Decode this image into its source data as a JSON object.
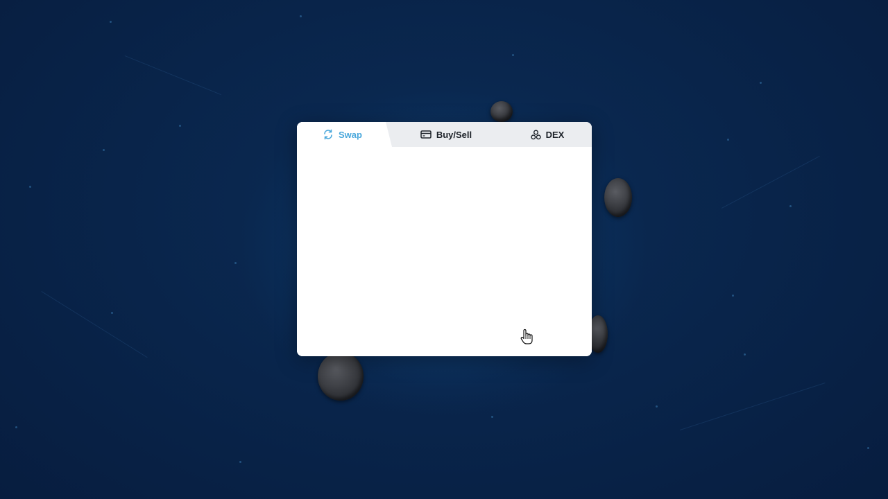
{
  "widget": {
    "tabs": [
      {
        "label": "Swap",
        "icon": "swap-arrows-icon",
        "active": true
      },
      {
        "label": "Buy/Sell",
        "icon": "credit-card-icon",
        "active": false
      },
      {
        "label": "DEX",
        "icon": "dex-nodes-icon",
        "active": false
      }
    ]
  },
  "colors": {
    "background": "#071d3f",
    "accent": "#4aa8dc",
    "tab_bar": "#ebedf0",
    "text": "#1d2229"
  },
  "cursor": {
    "icon": "hand-pointer-icon"
  }
}
